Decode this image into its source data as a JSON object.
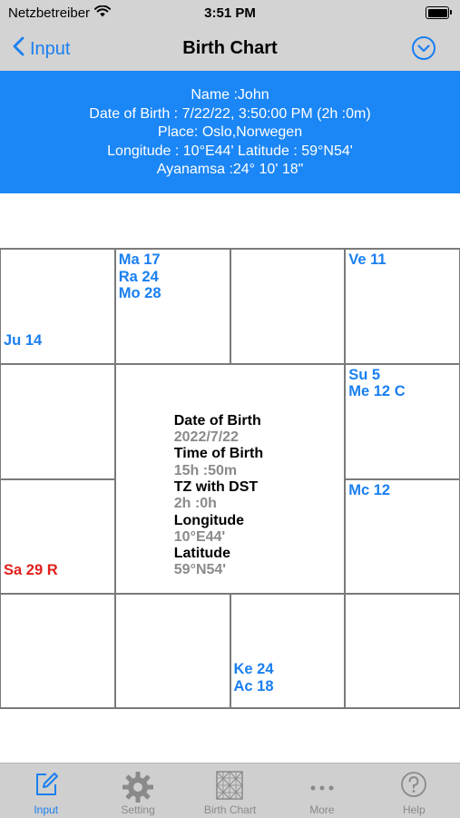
{
  "status_bar": {
    "carrier": "Netzbetreiber",
    "time": "3:51 PM",
    "icons": [
      "wifi-icon",
      "battery-icon"
    ]
  },
  "nav": {
    "back_label": "Input",
    "title": "Birth Chart",
    "menu_icon": "chevron-down-circle-icon"
  },
  "banner": {
    "name": "Name  :John",
    "dob": "Date of Birth  : 7/22/22, 3:50:00 PM (2h  :0m)",
    "place": "Place: Oslo,Norwegen",
    "coords": "Longitude  : 10°E44' Latitude  : 59°N54'",
    "ayanamsa": "Ayanamsa  :24° 10' 18\""
  },
  "chart": {
    "cells": {
      "r0c0": {
        "top": [],
        "bottom": "Ju 14"
      },
      "r0c1": {
        "top": [
          "Ma 17",
          "Ra 24",
          "Mo 28"
        ],
        "bottom": ""
      },
      "r0c2": {
        "top": [],
        "bottom": ""
      },
      "r0c3": {
        "top": [
          "Ve 11"
        ],
        "bottom": ""
      },
      "r1c0": {
        "top": [],
        "bottom": ""
      },
      "r1c3": {
        "top": [
          "Su 5",
          "Me 12 C"
        ],
        "bottom": ""
      },
      "r2c0": {
        "top": [],
        "bottom": "Sa 29 R"
      },
      "r2c3": {
        "top": [
          "Mc 12"
        ],
        "bottom": ""
      },
      "r3c0": {
        "top": [],
        "bottom": ""
      },
      "r3c1": {
        "top": [],
        "bottom": ""
      },
      "r3c2": {
        "top": [],
        "bottom": "Ke 24\nAc 18"
      },
      "r3c3": {
        "top": [],
        "bottom": ""
      }
    },
    "center": {
      "dob_label": "Date of Birth",
      "dob_value": "2022/7/22",
      "tob_label": "Time of Birth",
      "tob_value": "15h  :50m",
      "tz_label": "TZ with DST",
      "tz_value": "2h  :0h",
      "lon_label": "Longitude",
      "lon_value": "10°E44'",
      "lat_label": "Latitude",
      "lat_value": "59°N54'"
    },
    "colors": {
      "planet": "#1a7ff0",
      "retrograde": "#e0201d"
    }
  },
  "tabs": [
    {
      "label": "Input",
      "icon": "edit-icon",
      "active": true
    },
    {
      "label": "Setting",
      "icon": "gear-icon",
      "active": false
    },
    {
      "label": "Birth Chart",
      "icon": "chart-grid-icon",
      "active": false
    },
    {
      "label": "More",
      "icon": "more-icon",
      "active": false
    },
    {
      "label": "Help",
      "icon": "help-icon",
      "active": false
    }
  ],
  "colors": {
    "accent": "#1a7ff0",
    "banner": "#1b86f5",
    "bars": "#d3d3d3"
  }
}
